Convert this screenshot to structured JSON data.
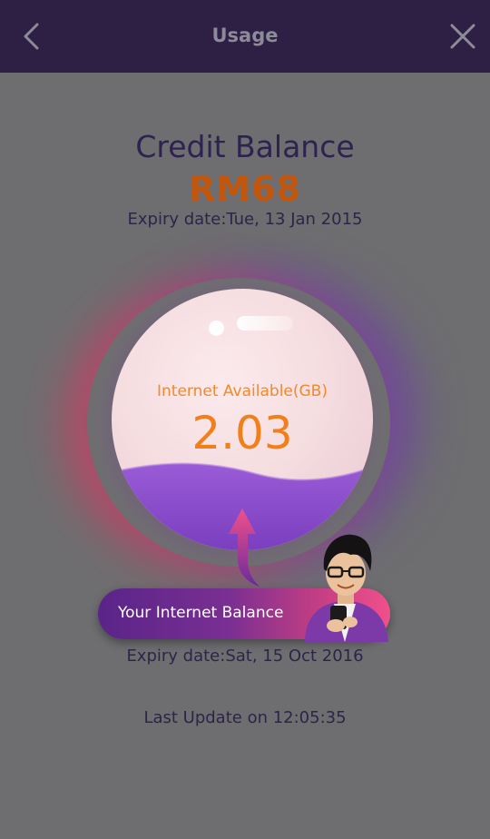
{
  "header": {
    "title": "Usage",
    "back_icon": "chevron-left-icon",
    "close_icon": "close-icon"
  },
  "credit": {
    "title": "Credit Balance",
    "amount": "RM68",
    "expiry": "Expiry date:Tue, 13 Jan 2015"
  },
  "internet": {
    "label": "Internet Available(GB)",
    "value": "2.03",
    "balance_label": "Your Internet Balance",
    "expiry": "Expiry date:Sat, 15 Oct 2016"
  },
  "footer": {
    "last_update": "Last Update on 12:05:35"
  },
  "colors": {
    "header_bg": "#2e1f45",
    "page_bg": "#6e6e70",
    "credit_amount": "#c2560c",
    "internet_value": "#f2801a",
    "wave": "#8c4fcf",
    "pill_start": "#5a2489",
    "pill_end": "#f0508c"
  }
}
